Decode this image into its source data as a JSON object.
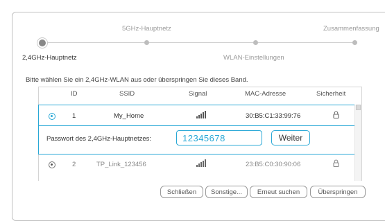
{
  "steps": [
    {
      "label": "2,4GHz-Hauptnetz",
      "state": "active"
    },
    {
      "label": "5GHz-Hauptnetz",
      "state": "pending"
    },
    {
      "label": "WLAN-Einstellungen",
      "state": "pending"
    },
    {
      "label": "Zusammenfassung",
      "state": "pending"
    }
  ],
  "instruction": "Bitte wählen Sie ein 2,4GHz-WLAN aus oder überspringen Sie dieses Band.",
  "table": {
    "headers": {
      "id": "ID",
      "ssid": "SSID",
      "signal": "Signal",
      "mac": "MAC-Adresse",
      "security": "Sicherheit"
    },
    "rows": [
      {
        "id": "1",
        "ssid": "My_Home",
        "mac": "30:B5:C1:33:99:76",
        "selected": true,
        "signal_bars": 4,
        "secured": true
      },
      {
        "id": "2",
        "ssid": "TP_Link_123456",
        "mac": "23:B5:C0:30:90:06",
        "selected": false,
        "signal_bars": 4,
        "secured": true
      }
    ]
  },
  "password": {
    "label": "Passwort des 2,4GHz-Hauptnetzes:",
    "value": "12345678",
    "next_label": "Weiter"
  },
  "footer": {
    "close": "Schließen",
    "other": "Sonstige...",
    "rescan": "Erneut suchen",
    "skip": "Überspringen"
  },
  "colors": {
    "accent": "#29a8d6"
  }
}
